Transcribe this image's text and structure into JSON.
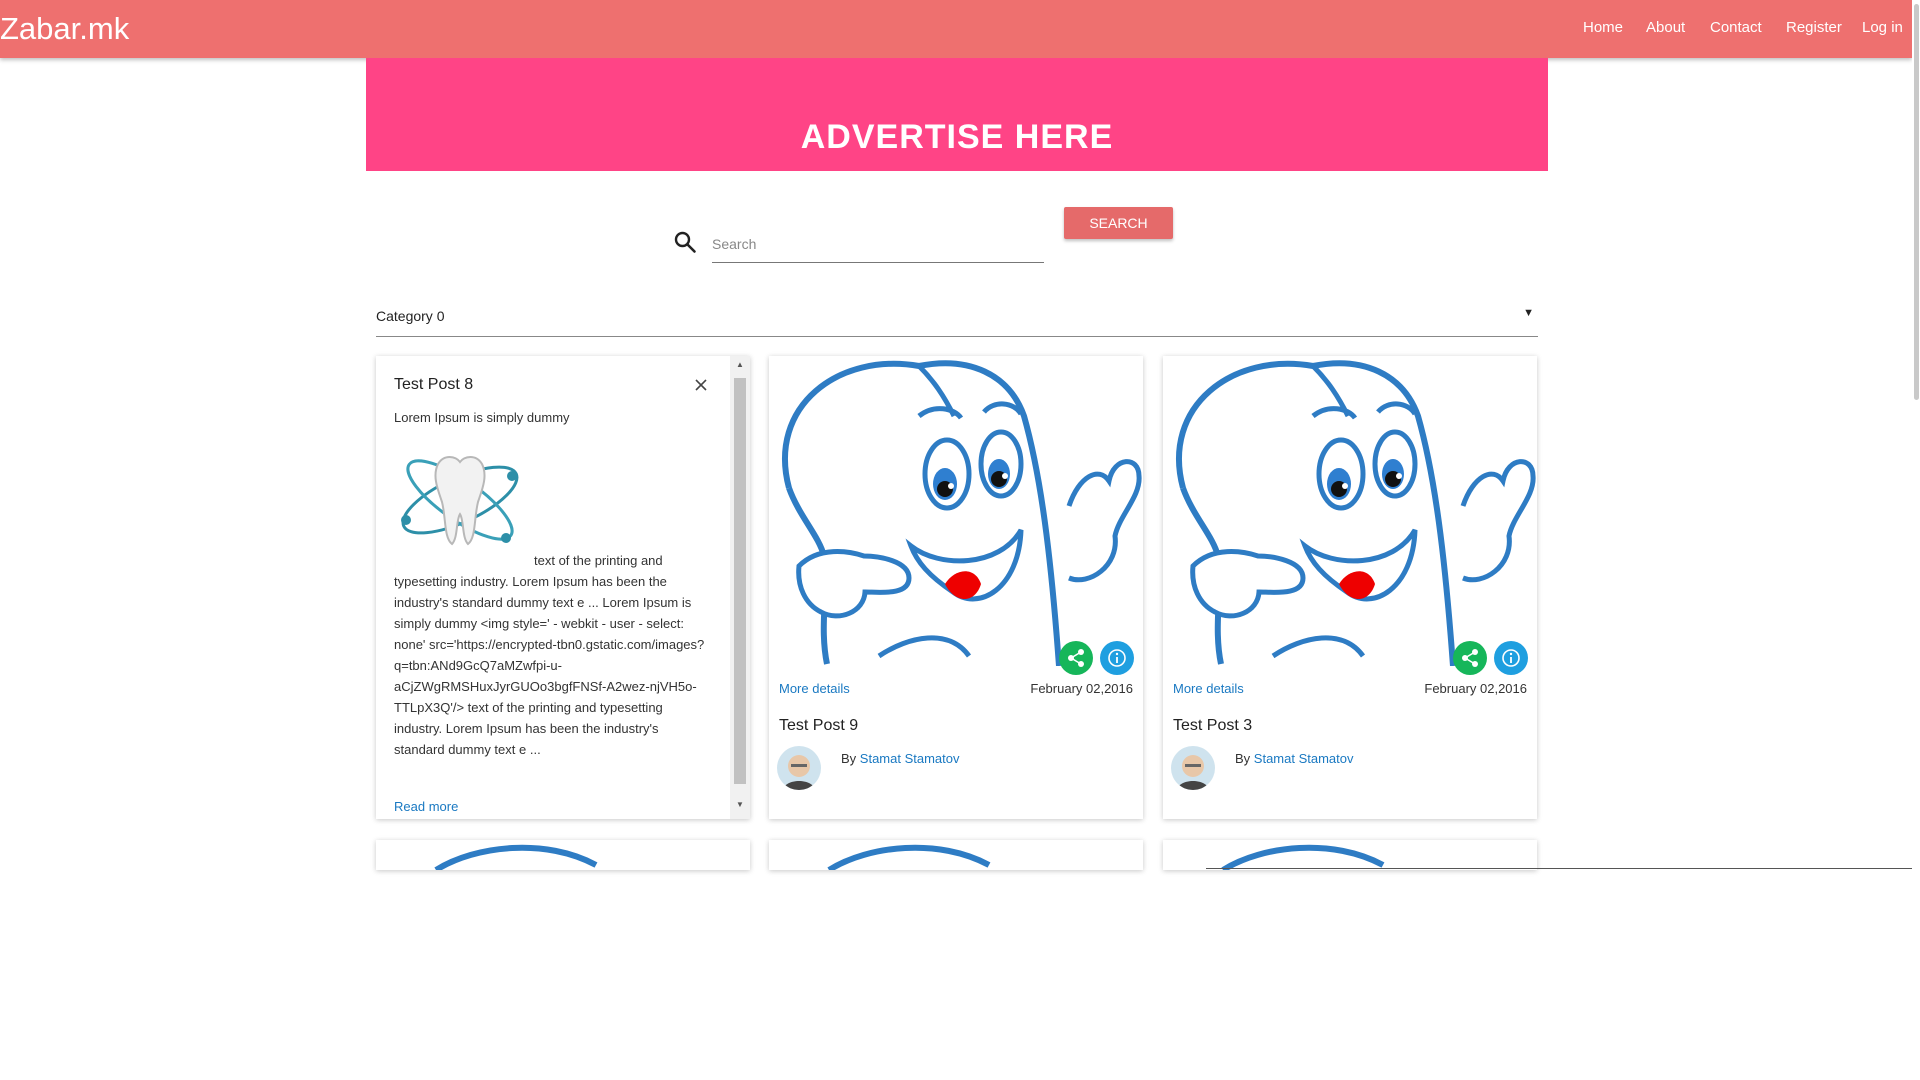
{
  "navbar": {
    "brand": "Zabar.mk",
    "links": [
      "Home",
      "About",
      "Contact",
      "Register",
      "Log in"
    ],
    "color": "#ee706f"
  },
  "ad": {
    "text": "ADVERTISE HERE",
    "color": "#ff4486"
  },
  "search": {
    "placeholder": "Search",
    "value": "",
    "button_label": "SEARCH",
    "icon": "search-icon"
  },
  "category": {
    "selected": "Category 0",
    "arrow": "▼"
  },
  "text_card": {
    "title": "Test Post 8",
    "close_glyph": "×",
    "intro": "Lorem Ipsum is simply dummy",
    "body": "text of the printing and typesetting industry. Lorem Ipsum has been the industry's standard dummy text e ... Lorem Ipsum is simply dummy <img style=' - webkit - user - select: none' src='https://encrypted-tbn0.gstatic.com/images?q=tbn:ANd9GcQ7aMZwfpi-u-aCjZWgRMSHuxJyrGUOo3bgfFNSf-A2wez-njVH5o-TTLpX3Q'/> text of the printing and typesetting industry. Lorem Ipsum has been the industry's standard dummy text e ...",
    "read_more": "Read more",
    "scroll_up": "▲",
    "scroll_down": "▼"
  },
  "posts": [
    {
      "title": "Test Post 9",
      "more": "More details",
      "date": "February 02,2016",
      "by": "By ",
      "author": "Stamat Stamatov"
    },
    {
      "title": "Test Post 3",
      "more": "More details",
      "date": "February 02,2016",
      "by": "By ",
      "author": "Stamat Stamatov"
    }
  ],
  "colors": {
    "share": "#16b65a",
    "info": "#1f9fe0",
    "link": "#1a79c2",
    "search_button": "#e56a6a"
  }
}
